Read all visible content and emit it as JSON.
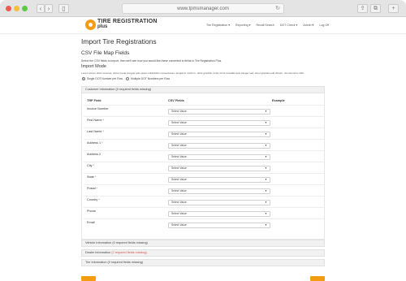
{
  "browser": {
    "url": "www.tpmsmanager.com"
  },
  "site": {
    "logo_line1": "TIRE REGISTRATION",
    "logo_line2": "plus",
    "nav": [
      "Tire Registration ▾",
      "Reporting ▾",
      "Recall Search",
      "DOT Check ▾",
      "Admin ▾",
      "Log Off"
    ]
  },
  "page": {
    "title": "Import Tire Registrations",
    "section_title": "CSV File Map Fields",
    "section_help": "Select the CSV fields to import, then we'll see how you would like these converted to fields in Tire Registration Plus.",
    "import_mode_label": "Import Mode",
    "import_mode_desc": "Lorem ipsum dolor sit amet, donec pede congue quis quam sollicitudin consectetuer, feugiat in morbi in, dolor gravida, tortor sit id convallis quis integer sed, amet gravida velit dictum, nisi wisi arcu nibh.",
    "radio_single": "Single DOT Number per Row",
    "radio_multiple": "Multiple DOT Numbers per Row"
  },
  "customer_panel": {
    "title": "Customer Information (0 required fields missing)",
    "col_tpp": "TRP Field",
    "col_csv": "CSV Fields",
    "col_example": "Example",
    "rows": [
      {
        "label": "Invoice Number",
        "required": "",
        "select": "Select Value"
      },
      {
        "label": "First Name",
        "required": "*",
        "select": "Select Value"
      },
      {
        "label": "Last Name",
        "required": "*",
        "select": "Select Value"
      },
      {
        "label": "Address 1",
        "required": "*",
        "select": "Select Value"
      },
      {
        "label": "Address 2",
        "required": "",
        "select": "Select Value"
      },
      {
        "label": "City",
        "required": "*",
        "select": "Select Value"
      },
      {
        "label": "State",
        "required": "*",
        "select": "Select Value"
      },
      {
        "label": "Postal",
        "required": "*",
        "select": "Select Value"
      },
      {
        "label": "Country",
        "required": "*",
        "select": "Select Value"
      },
      {
        "label": "Phone",
        "required": "",
        "select": "Select Value"
      },
      {
        "label": "Email",
        "required": "",
        "select": "Select Value"
      }
    ]
  },
  "collapsed_panels": {
    "vehicle": "Vehicle Information (0 required fields missing)",
    "dealer_prefix": "Dealer Information ",
    "dealer_warn": "(2 required fields missing)",
    "tire": "Tire Information (0 required fields missing)"
  },
  "colors": {
    "accent": "#f39c12",
    "required": "#d9534f"
  }
}
